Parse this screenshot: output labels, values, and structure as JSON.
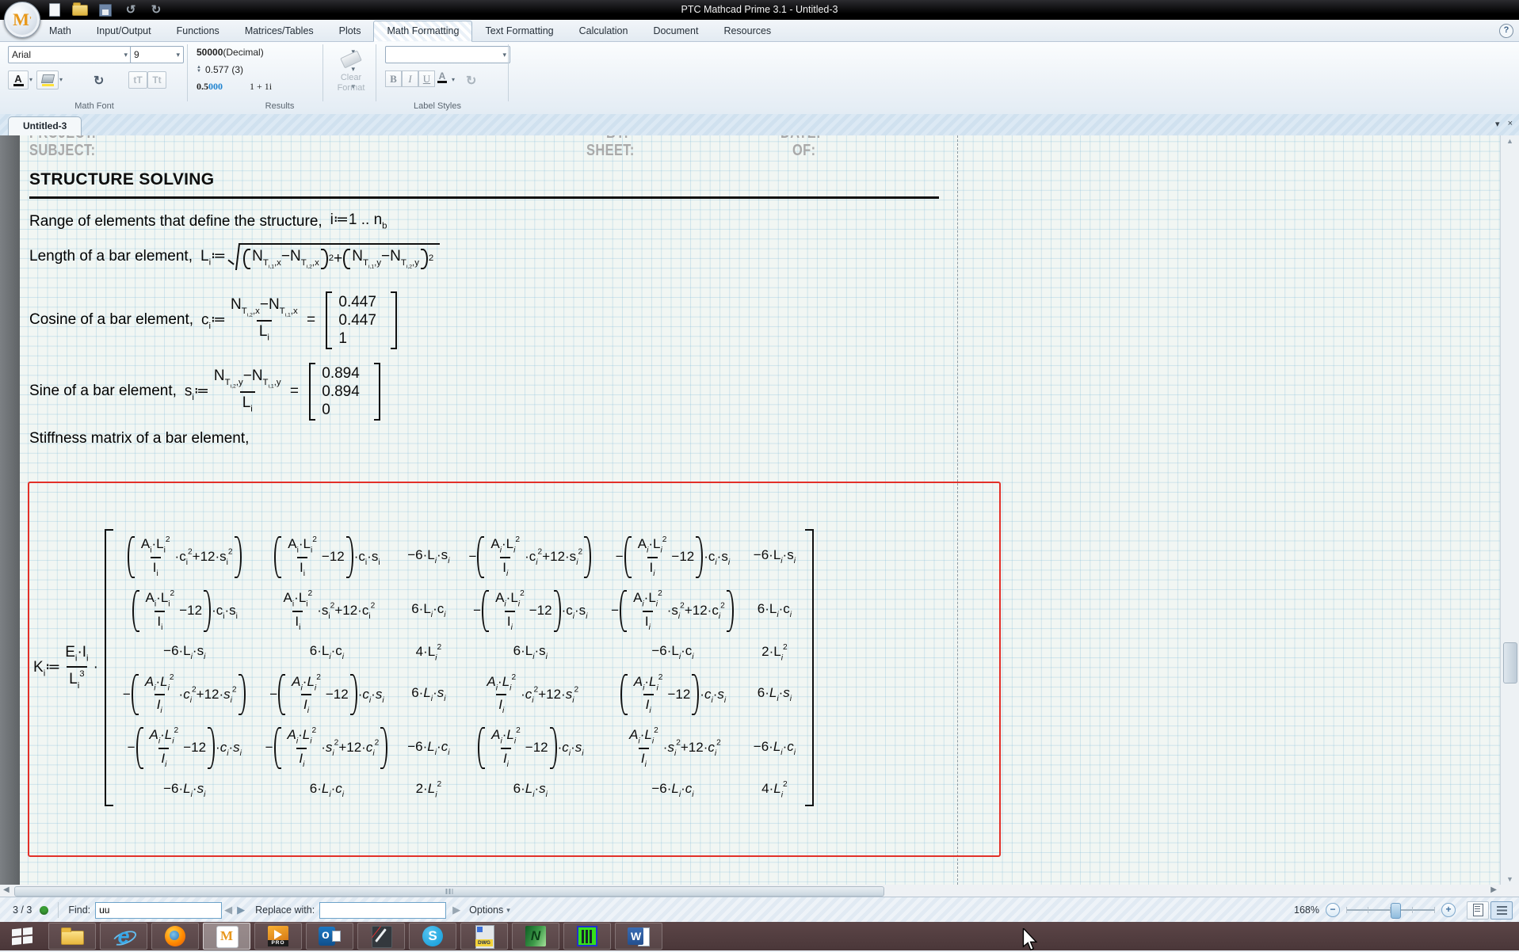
{
  "window": {
    "title": "PTC Mathcad Prime 3.1 - Untitled-3",
    "help_label": "?"
  },
  "quick_access": [
    {
      "id": "new-document"
    },
    {
      "id": "open-file"
    },
    {
      "id": "save"
    },
    {
      "id": "undo",
      "glyph": "↺"
    },
    {
      "id": "redo",
      "glyph": "↻"
    }
  ],
  "ribbon": {
    "tabs": [
      {
        "label": "Math"
      },
      {
        "label": "Input/Output"
      },
      {
        "label": "Functions"
      },
      {
        "label": "Matrices/Tables"
      },
      {
        "label": "Plots"
      },
      {
        "label": "Math Formatting",
        "active": true
      },
      {
        "label": "Text Formatting"
      },
      {
        "label": "Calculation"
      },
      {
        "label": "Document"
      },
      {
        "label": "Resources"
      }
    ],
    "math_font": {
      "group_label": "Math Font",
      "font_name": "Arial",
      "font_size": "9",
      "color_letter": "A",
      "small_t": "tT",
      "big_t": "Tt"
    },
    "results": {
      "group_label": "Results",
      "row1_bold": "50000",
      "row1_rest": " (Decimal)",
      "row2": "0.577 (3)",
      "row3_black": "0.5",
      "row3_blue": "000",
      "row3_sample": "1 + 1i"
    },
    "clear_format": {
      "line1": "Clear",
      "line2": "Format"
    },
    "label_styles": {
      "group_label": "Label Styles",
      "bold": "B",
      "italic": "I",
      "underline": "U",
      "color_letter": "A"
    }
  },
  "document_tab": {
    "label": "Untitled-3",
    "chevron": "▾",
    "close": "×"
  },
  "worksheet": {
    "header_ghost": {
      "project": "PROJECT:",
      "by": "BY:",
      "date": "DATE:"
    },
    "header": {
      "subject": "SUBJECT:",
      "sheet": "SHEET:",
      "of": "OF:"
    },
    "heading": "STRUCTURE SOLVING",
    "lines": [
      {
        "label": "Range of elements that define the structure,",
        "math": {
          "e": "i≔1 .. n_{b}",
          "it": 0
        }
      },
      {
        "label": "Length of a bar element,",
        "math": {
          "e": "L_{i}≔@r{@p{N_{T_{i,1},x}−N_{T_{i,2},x}}@h{2}+@p{N_{T_{i,1},y}−N_{T_{i,2},y}}@h{2}}",
          "it": 0
        }
      },
      {
        "label": "Cosine of a bar element,",
        "math": {
          "e": "c_{i}≔@f{N_{T_{i,2},x}−N_{T_{i,1},x}}{L_{i}} = @v{0.447|0.447|1}",
          "it": 0
        }
      },
      {
        "label": "Sine of a bar element,",
        "math": {
          "e": "s_{i}≔@f{N_{T_{i,2},y}−N_{T_{i,1},y}}{L_{i}} = @v{0.894|0.894|0}",
          "it": 0
        }
      },
      {
        "label": "Stiffness matrix of a bar element,"
      }
    ],
    "k_equation": {
      "lhs": {
        "e": "K_{i}≔@f{E_{i}·I_{i}}{L_{i}^{3}}·",
        "it": 0
      },
      "rows": [
        [
          {
            "e": "@p{@f{A_{i}·L_{i}^{2}}{I_{i}}·c_{i}^{2}+12·s_{i}^{2}}",
            "it": 0
          },
          {
            "e": "@p{@f{A_{i}·L_{i}^{2}}{I_{i}}−12}·c_{i}·s_{i}",
            "it": 0
          },
          {
            "e": "−6·L_{i}·s_{i}",
            "it": 1
          },
          {
            "e": "−@p{@f{A_{i}·L_{i}^{2}}{I_{i}}·c_{i}^{2}+12·s_{i}^{2}}",
            "it": 1
          },
          {
            "e": "−@p{@f{A_{i}·L_{i}^{2}}{I_{i}}−12}·c_{i}·s_{i}",
            "it": 1
          },
          {
            "e": "−6·L_{i}·s_{i}",
            "it": 1
          }
        ],
        [
          {
            "e": "@p{@f{A_{i}·L_{i}^{2}}{I_{i}}−12}·c_{i}·s_{i}",
            "it": 0
          },
          {
            "e": "@f{A_{i}·L_{i}^{2}}{I_{i}}·s_{i}^{2}+12·c_{i}^{2}",
            "it": 0
          },
          {
            "e": "6·L_{i}·c_{i}",
            "it": 1
          },
          {
            "e": "−@p{@f{A_{i}·L_{i}^{2}}{I_{i}}−12}·c_{i}·s_{i}",
            "it": 1
          },
          {
            "e": "−@p{@f{A_{i}·L_{i}^{2}}{I_{i}}·s_{i}^{2}+12·c_{i}^{2}}",
            "it": 1
          },
          {
            "e": "6·L_{i}·c_{i}",
            "it": 1
          }
        ],
        [
          {
            "e": "−6·L_{i}·s_{i}",
            "it": 1
          },
          {
            "e": "6·L_{i}·c_{i}",
            "it": 1
          },
          {
            "e": "4·L_{i}^{2}",
            "it": 1
          },
          {
            "e": "6·L_{i}·s_{i}",
            "it": 1
          },
          {
            "e": "−6·L_{i}·c_{i}",
            "it": 1
          },
          {
            "e": "2·L_{i}^{2}",
            "it": 1
          }
        ],
        [
          {
            "e": "−@p{@f{A_{i}·L_{i}^{2}}{I_{i}}·c_{i}^{2}+12·s_{i}^{2}}",
            "it": 2
          },
          {
            "e": "−@p{@f{A_{i}·L_{i}^{2}}{I_{i}}−12}·c_{i}·s_{i}",
            "it": 2
          },
          {
            "e": "6·L_{i}·s_{i}",
            "it": 2
          },
          {
            "e": "@f{A_{i}·L_{i}^{2}}{I_{i}}·c_{i}^{2}+12·s_{i}^{2}",
            "it": 2
          },
          {
            "e": "@p{@f{A_{i}·L_{i}^{2}}{I_{i}}−12}·c_{i}·s_{i}",
            "it": 2
          },
          {
            "e": "6·L_{i}·s_{i}",
            "it": 2
          }
        ],
        [
          {
            "e": "−@p{@f{A_{i}·L_{i}^{2}}{I_{i}}−12}·c_{i}·s_{i}",
            "it": 2
          },
          {
            "e": "−@p{@f{A_{i}·L_{i}^{2}}{I_{i}}·s_{i}^{2}+12·c_{i}^{2}}",
            "it": 2
          },
          {
            "e": "−6·L_{i}·c_{i}",
            "it": 2
          },
          {
            "e": "@p{@f{A_{i}·L_{i}^{2}}{I_{i}}−12}·c_{i}·s_{i}",
            "it": 2
          },
          {
            "e": "@f{A_{i}·L_{i}^{2}}{I_{i}}·s_{i}^{2}+12·c_{i}^{2}",
            "it": 2
          },
          {
            "e": "−6·L_{i}·c_{i}",
            "it": 2
          }
        ],
        [
          {
            "e": "−6·L_{i}·s_{i}",
            "it": 2
          },
          {
            "e": "6·L_{i}·c_{i}",
            "it": 2
          },
          {
            "e": "2·L_{i}^{2}",
            "it": 2
          },
          {
            "e": "6·L_{i}·s_{i}",
            "it": 2
          },
          {
            "e": "−6·L_{i}·c_{i}",
            "it": 2
          },
          {
            "e": "4·L_{i}^{2}",
            "it": 2
          }
        ]
      ]
    }
  },
  "statusbar": {
    "position_count": "3 / 3",
    "find_label": "Find:",
    "find_value": "uu",
    "replace_label": "Replace with:",
    "replace_value": "",
    "options_label": "Options",
    "zoom_level": "168%",
    "zoom_out": "−",
    "zoom_in": "+"
  },
  "taskbar": {
    "icons": [
      {
        "id": "file-explorer"
      },
      {
        "id": "internet-explorer",
        "glyph": "e"
      },
      {
        "id": "firefox"
      },
      {
        "id": "mathcad",
        "glyph": "M",
        "active": true
      },
      {
        "id": "creo",
        "glyph": "PRO"
      },
      {
        "id": "outlook",
        "glyph": "o"
      },
      {
        "id": "journal"
      },
      {
        "id": "skype",
        "glyph": "S"
      },
      {
        "id": "dwg",
        "glyph": "DWG"
      },
      {
        "id": "green-n",
        "glyph": "N"
      },
      {
        "id": "cad-green"
      },
      {
        "id": "word",
        "glyph": "W"
      }
    ]
  },
  "colors": {
    "selection_red": "#e23028",
    "result_blue": "#1e83d0",
    "status_green": "#3a9e35"
  }
}
